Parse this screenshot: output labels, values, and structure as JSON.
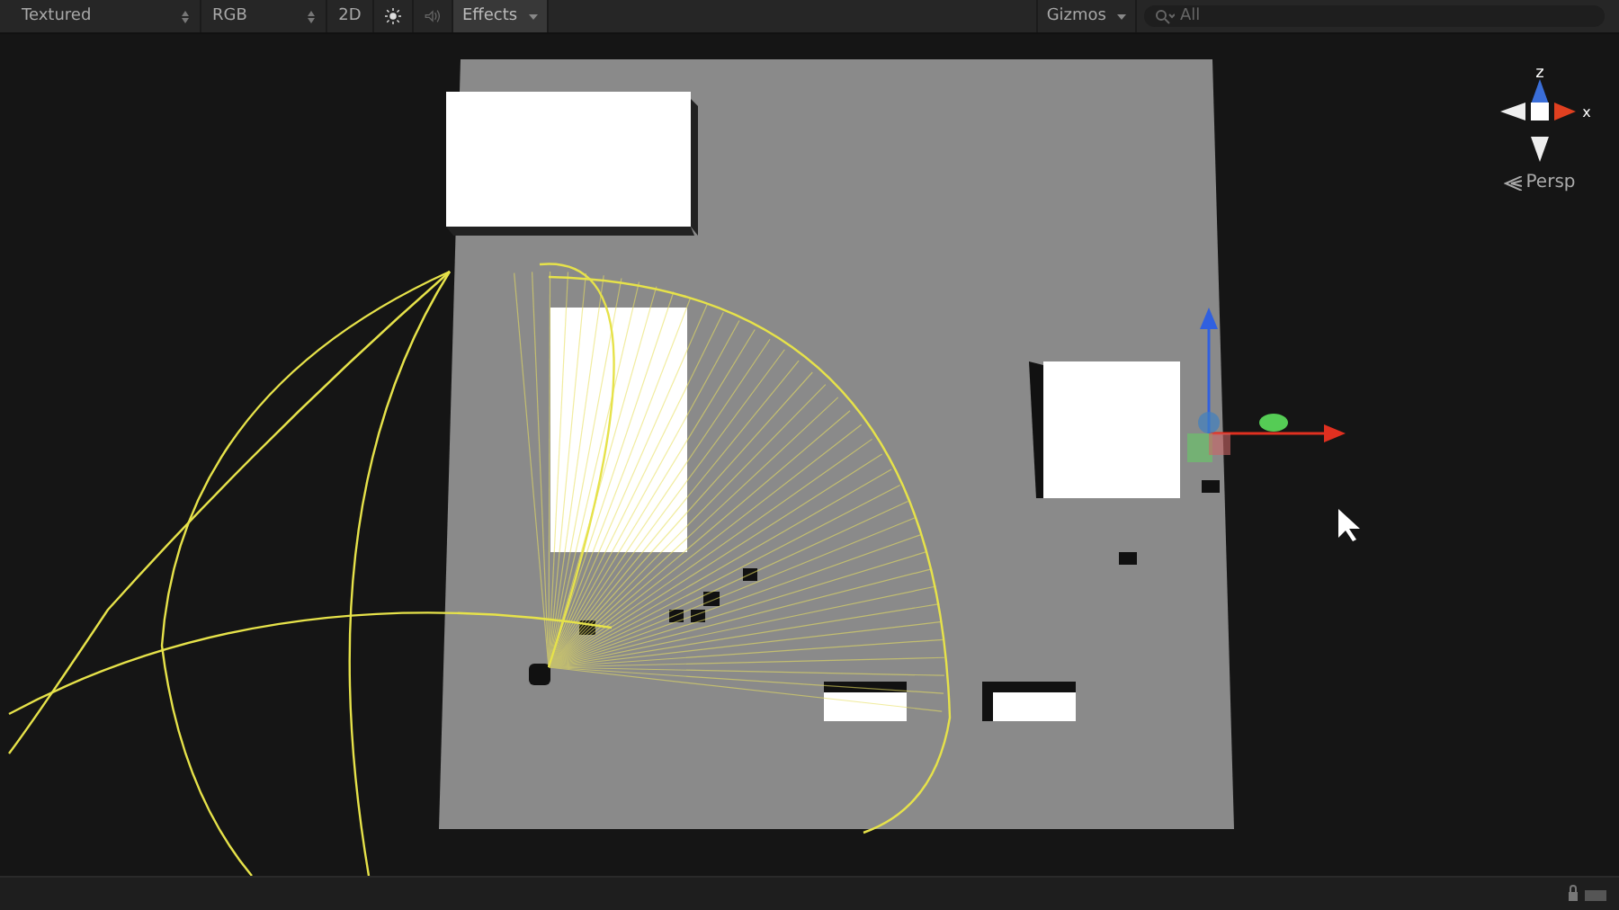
{
  "toolbar": {
    "items": [
      {
        "kind": "dropdown",
        "label": "Textured"
      },
      {
        "kind": "dropdown",
        "label": "RGB"
      },
      {
        "kind": "toggle",
        "label": "2D",
        "on": false
      },
      {
        "kind": "light",
        "on": true
      },
      {
        "kind": "audio",
        "on": false
      },
      {
        "kind": "menu",
        "label": "Effects",
        "on": true
      }
    ],
    "gizmos": {
      "label": "Gizmos"
    },
    "search": {
      "placeholder": "All"
    }
  },
  "axis_gizmo": {
    "z_label": "z",
    "x_label": "x",
    "projection": "Persp"
  }
}
